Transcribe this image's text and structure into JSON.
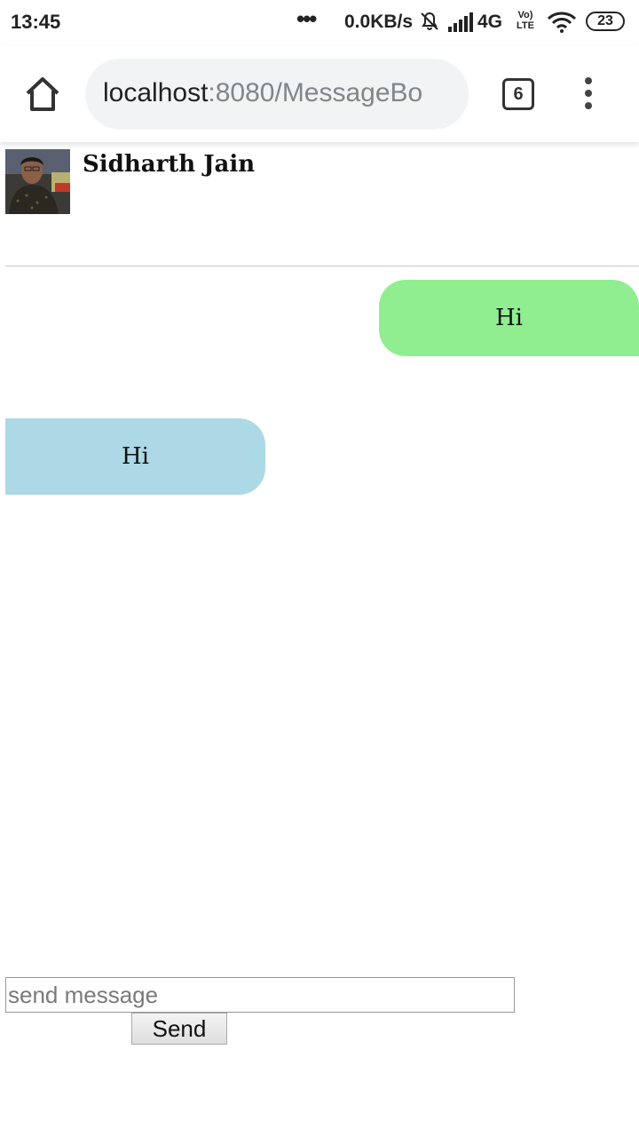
{
  "status_bar": {
    "time": "13:45",
    "dots": "•••",
    "net_speed": "0.0KB/s",
    "network": "4G",
    "volte_top": "Vo)",
    "volte_bottom": "LTE",
    "battery": "23",
    "icons": [
      "bell-off-icon",
      "signal-icon",
      "wifi-icon",
      "battery-icon"
    ]
  },
  "browser": {
    "url_host": "localhost",
    "url_rest": ":8080/MessageBo",
    "tab_count": "6",
    "icons": [
      "home-icon",
      "tabs-icon",
      "more-vert-icon"
    ]
  },
  "chat": {
    "contact_name": "Sidharth Jain",
    "messages": [
      {
        "direction": "outgoing",
        "text": "Hi",
        "color": "#90ee90"
      },
      {
        "direction": "incoming",
        "text": "Hi",
        "color": "#add8e6"
      }
    ]
  },
  "composer": {
    "placeholder": "send message",
    "value": "",
    "send_label": "Send"
  }
}
